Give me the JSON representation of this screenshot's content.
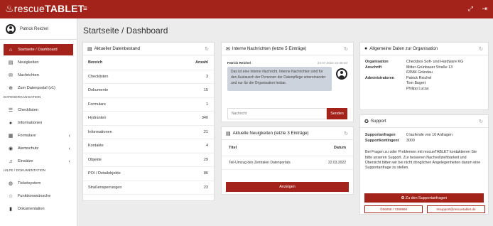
{
  "app": {
    "brand_prefix": "rescue",
    "brand_main": "TABLET"
  },
  "header": {
    "menu_icon": "menu-icon",
    "icons": [
      "expand-icon",
      "logout-icon"
    ]
  },
  "user": {
    "name": "Patrick Reichel"
  },
  "sidebar": {
    "items": [
      {
        "label": "Startseite / Dashboard",
        "icon": "home-icon",
        "active": true
      },
      {
        "label": "Neuigkeiten",
        "icon": "newspaper-icon"
      },
      {
        "label": "Nachrichten",
        "icon": "envelope-icon"
      },
      {
        "label": "Zum Datenportal (v1)",
        "icon": "arrow-circle-icon"
      }
    ],
    "section_data": "DATENORGANISATION",
    "data_items": [
      {
        "label": "Checklisten",
        "icon": "list-icon"
      },
      {
        "label": "Informationen",
        "icon": "info-icon"
      },
      {
        "label": "Formulare",
        "icon": "form-icon",
        "chevron": true
      },
      {
        "label": "Atemschutz",
        "icon": "mask-icon",
        "chevron": true
      },
      {
        "label": "Einsätze",
        "icon": "bell-icon",
        "chevron": true
      }
    ],
    "section_help": "HILFE / DOKUMENTATION",
    "help_items": [
      {
        "label": "Ticketsystem",
        "icon": "ticket-icon"
      },
      {
        "label": "Funktionswünsche",
        "icon": "star-icon"
      },
      {
        "label": "Dokumentation",
        "icon": "book-icon"
      }
    ]
  },
  "page": {
    "title": "Startseite / Dashboard"
  },
  "stock": {
    "title": "Aktueller Datenbestand",
    "col_area": "Bereich",
    "col_count": "Anzahl",
    "rows": [
      {
        "area": "Checklisten",
        "count": "3"
      },
      {
        "area": "Dokumente",
        "count": "15"
      },
      {
        "area": "Formulare",
        "count": "1"
      },
      {
        "area": "Hydranten",
        "count": "340"
      },
      {
        "area": "Informationen",
        "count": "21"
      },
      {
        "area": "Kontakte",
        "count": "4"
      },
      {
        "area": "Objekte",
        "count": "29"
      },
      {
        "area": "POI / Detailobjekte",
        "count": "86"
      },
      {
        "area": "Straßensperrungen",
        "count": "23"
      }
    ]
  },
  "messages": {
    "title": "Interne Nachrichten (letzte 5 Einträge)",
    "author": "Patrick Reichel",
    "date": "23.07.2022 22:38:33",
    "text": "Das ist eine interne Nachricht. Interne Nachrichten sind für den Austausch der Personen der Datenpflege untereinander und nur für die Organisation lesbar.",
    "input_placeholder": "Nachricht",
    "send_label": "Senden"
  },
  "news": {
    "title": "Aktuelle Neuigkeiten (letzte 3 Einträge)",
    "col_title": "Titel",
    "col_date": "Datum",
    "rows": [
      {
        "title": "Teil-Umzug des Zentralen Datenportals",
        "date": "22.03.2022"
      }
    ],
    "show_label": "Anzeigen"
  },
  "org": {
    "title": "Allgemeine Daten zur Organisation",
    "org_label": "Organisation",
    "org_value": "Checkbox Soft- und Hardware KG",
    "addr_label": "Anschrift",
    "addr_lines": [
      "Mitter-Grünbauer Straße 13",
      "63584 Gründau"
    ],
    "admins_label": "Administratoren",
    "admins": [
      "Patrick Reichel",
      "Tom Bugert",
      "Philipp Lucas"
    ]
  },
  "support": {
    "title": "Support",
    "requests_label": "Supportanfragen",
    "requests_value": "0 laufende von 10 Anfragen",
    "quota_label": "Supportkontingent",
    "quota_value": "3000",
    "text": "Bei Fragen zu oder Problemen mit rescueTABLET kontaktieren Sie bitte unseren Support. Zur besseren Nachvollziehbarkeit und Übersicht bitten wir bei nicht dringlichen Angelegenheiten darum eine Supportanfrage zu stellen.",
    "requests_button": "Zu den Supportanfragen",
    "phone": "06058 / 7299990",
    "email": "support@rescuetablet.de"
  },
  "colors": {
    "brand": "#a3231a",
    "bubble": "#ccd3dc",
    "background": "#ececec"
  }
}
